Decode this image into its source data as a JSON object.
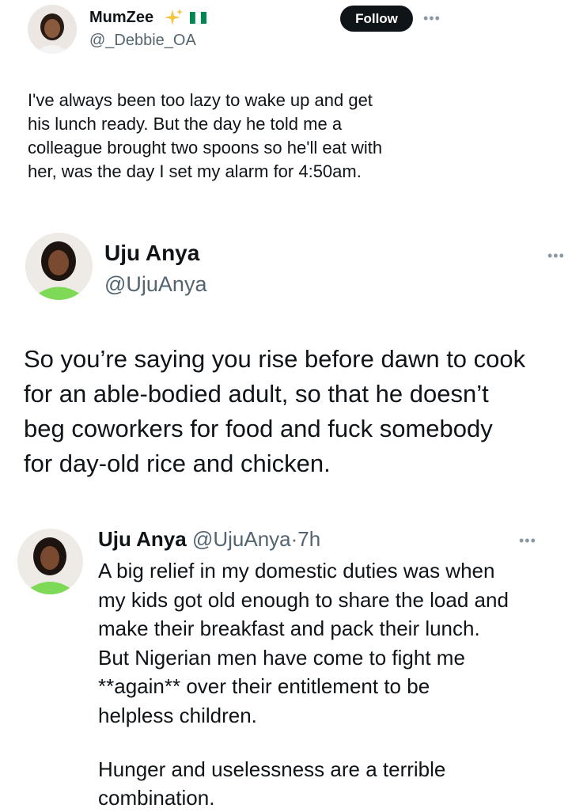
{
  "tweet1": {
    "display_name": "MumZee",
    "handle": "@_Debbie_OA",
    "follow_label": "Follow",
    "more_icon": "ellipsis-icon",
    "sparkle_icon": "sparkles-icon",
    "flag_icon": "nigeria-flag-icon",
    "flag_colors": [
      "#008751",
      "#ffffff",
      "#008751"
    ],
    "lines": [
      "I've always been too lazy to wake up and get",
      "his lunch ready. But the day he told me a",
      "colleague brought two spoons so he'll eat with",
      "her, was the day I set my alarm for 4:50am."
    ]
  },
  "tweet2": {
    "display_name": "Uju Anya",
    "handle": "@UjuAnya",
    "more_icon": "ellipsis-icon",
    "lines": [
      "So you’re saying you rise before dawn to cook",
      "for an able-bodied adult, so that he doesn’t",
      "beg coworkers for food and fuck somebody",
      "for day-old rice and chicken."
    ]
  },
  "tweet3": {
    "display_name": "Uju Anya",
    "handle": "@UjuAnya",
    "separator": "·",
    "time": "7h",
    "more_icon": "ellipsis-icon",
    "lines": [
      "A big relief in my domestic duties was when",
      "my kids got old enough to share the load and",
      "make their breakfast and pack their lunch.",
      "But Nigerian men have come to fight me",
      "**again** over their entitlement to be",
      "helpless children."
    ],
    "lines2": [
      "Hunger and uselessness are a terrible",
      "combination."
    ]
  }
}
